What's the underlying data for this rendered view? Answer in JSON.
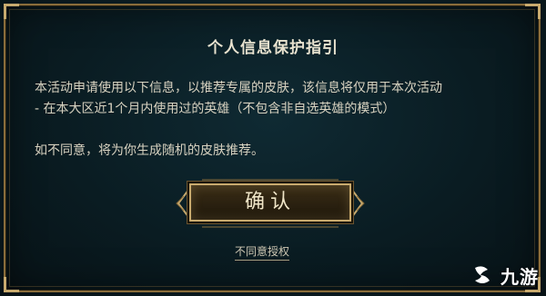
{
  "dialog": {
    "title": "个人信息保护指引",
    "line1": "本活动申请使用以下信息，以推荐专属的皮肤，该信息将仅用于本次活动",
    "line2": "- 在本大区近1个月内使用过的英雄（不包含非自选英雄的模式）",
    "line3": "如不同意，将为你生成随机的皮肤推荐。",
    "confirm_label": "确认",
    "decline_label": "不同意授权"
  },
  "watermark": {
    "text": "九游",
    "icon": "jiuyou-logo-icon"
  },
  "colors": {
    "gold": "#c8aa6e",
    "background": "#0a1c22",
    "text": "#d8d2c0"
  }
}
